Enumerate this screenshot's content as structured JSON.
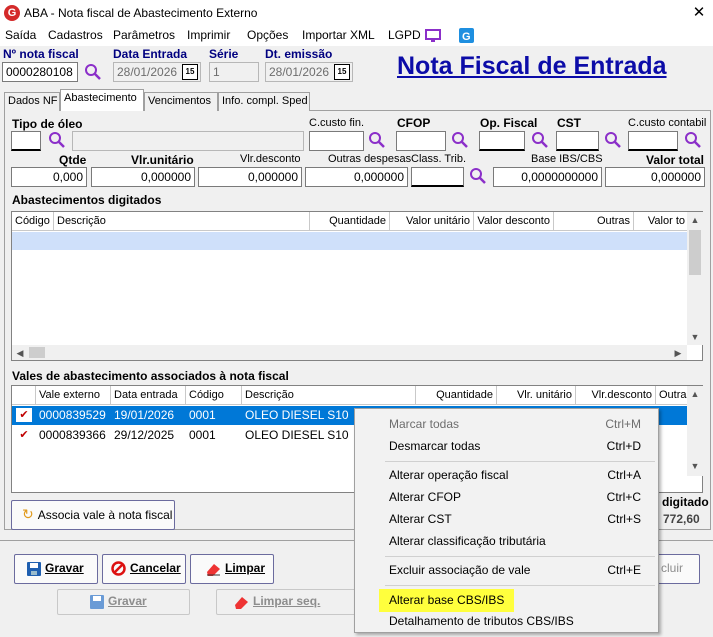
{
  "window": {
    "title": "ABA - Nota fiscal de Abastecimento Externo",
    "close": "✕",
    "app_letter": "G"
  },
  "menu": [
    "Saída",
    "Cadastros",
    "Parâmetros",
    "Imprimir",
    "Opções",
    "Importar XML",
    "LGPD"
  ],
  "header": {
    "nota_label": "Nº nota fiscal",
    "nota_value": "0000280108",
    "entrada_label": "Data Entrada",
    "entrada_value": "28/01/2026",
    "serie_label": "Série",
    "serie_value": "1",
    "emissao_label": "Dt. emissão",
    "emissao_value": "28/01/2026",
    "big_title": "Nota Fiscal de Entrada",
    "cal_glyph": "15"
  },
  "tabs": [
    "Dados NF",
    "Abastecimento",
    "Vencimentos",
    "Info. compl. Sped"
  ],
  "form": {
    "tipo_oleo": "Tipo de óleo",
    "ccusto_fin": "C.custo fin.",
    "cfop": "CFOP",
    "op_fiscal": "Op. Fiscal",
    "cst": "CST",
    "ccusto_contabil": "C.custo contabil",
    "qtde": "Qtde",
    "qtde_value": "0,000",
    "vlr_unitario": "Vlr.unitário",
    "vlr_unitario_value": "0,000000",
    "vlr_desconto": "Vlr.desconto",
    "vlr_desconto_value": "0,000000",
    "outras_despesas": "Outras despesas",
    "outras_despesas_value": "0,000000",
    "class_trib": "Class. Trib.",
    "base_ibs": "Base IBS/CBS",
    "base_ibs_value": "0,0000000000",
    "valor_total": "Valor total",
    "valor_total_value": "0,000000"
  },
  "grid1": {
    "title": "Abastecimentos digitados",
    "columns": [
      "Código",
      "Descrição",
      "Quantidade",
      "Valor unitário",
      "Valor desconto",
      "Outras",
      "Valor to"
    ]
  },
  "grid2": {
    "title": "Vales de abastecimento associados à nota fiscal",
    "columns": [
      "Vale externo",
      "Data entrada",
      "Código",
      "Descrição",
      "Quantidade",
      "Vlr. unitário",
      "Vlr.desconto",
      "Outras"
    ],
    "rows": [
      {
        "vale": "0000839529",
        "data": "19/01/2026",
        "codigo": "0001",
        "descricao": "OLEO DIESEL S10"
      },
      {
        "vale": "0000839366",
        "data": "29/12/2025",
        "codigo": "0001",
        "descricao": "OLEO DIESEL S10"
      }
    ],
    "check_glyph": "✔"
  },
  "associa_button": "Associa vale à nota fiscal",
  "total": {
    "label": "digitado",
    "value": "772,60"
  },
  "buttons": {
    "gravar": "Gravar",
    "cancelar": "Cancelar",
    "limpar": "Limpar",
    "excluir": "cluir",
    "gravar2": "Gravar",
    "limpar_seq": "Limpar seq."
  },
  "context_menu": [
    {
      "label": "Marcar todas",
      "shortcut": "Ctrl+M",
      "disabled": true
    },
    {
      "label": "Desmarcar todas",
      "shortcut": "Ctrl+D"
    },
    {
      "label": "Alterar operação fiscal",
      "shortcut": "Ctrl+A"
    },
    {
      "label": "Alterar CFOP",
      "shortcut": "Ctrl+C"
    },
    {
      "label": "Alterar CST",
      "shortcut": "Ctrl+S"
    },
    {
      "label": "Alterar classificação tributária",
      "shortcut": ""
    },
    {
      "label": "Excluir associação de vale",
      "shortcut": "Ctrl+E"
    },
    {
      "label": "Alterar base CBS/IBS",
      "shortcut": "",
      "highlight": "#ffff3d"
    },
    {
      "label": "Detalhamento de tributos CBS/IBS",
      "shortcut": ""
    }
  ],
  "colors": {
    "accent": "#0078d7",
    "title_blue": "#0c0ca8",
    "selection": "#0078d7",
    "check_red": "#c00000"
  }
}
